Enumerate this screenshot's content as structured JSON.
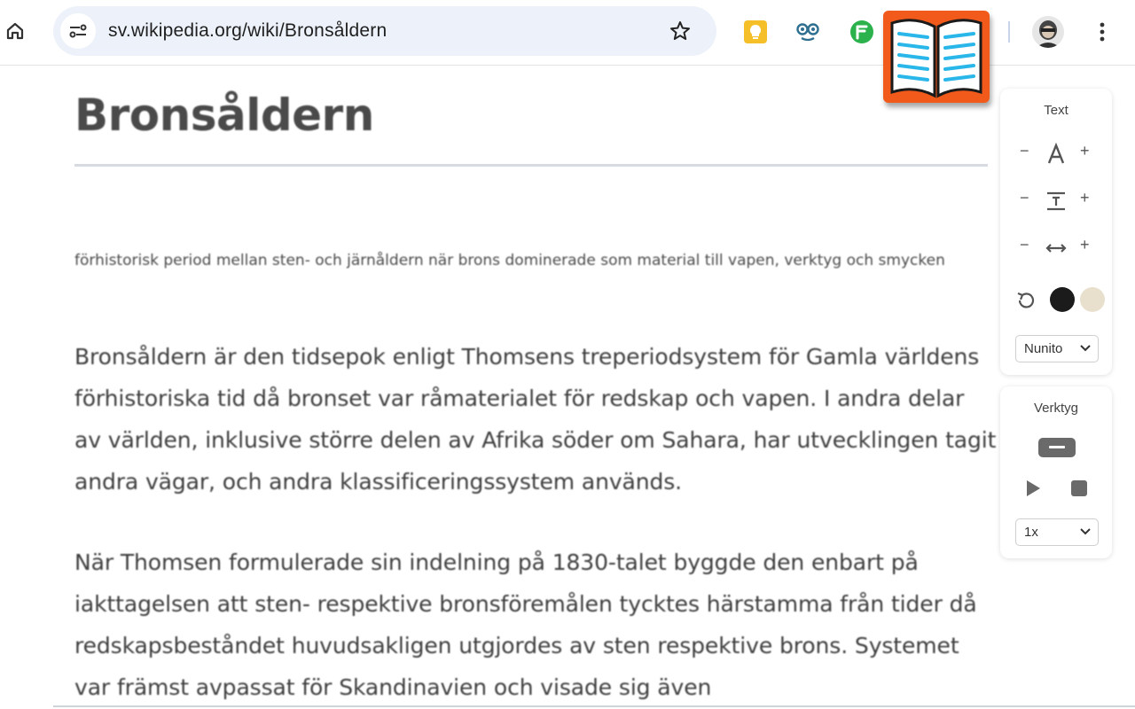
{
  "browser": {
    "url": "sv.wikipedia.org/wiki/Bronsåldern"
  },
  "article": {
    "title": "Bronsåldern",
    "short_description": "förhistorisk period mellan sten- och järnåldern när brons dominerade som material till vapen, verktyg och smycken",
    "paragraphs": [
      "Bronsåldern är den tidsepok enligt Thomsens treperiodsystem för Gamla världens förhistoriska tid då bronset var råmaterialet för redskap och vapen. I andra delar av världen, inklusive större delen av Afrika söder om Sahara, har utvecklingen tagit andra vägar, och andra klassificeringssystem används.",
      "När Thomsen formulerade sin indelning på 1830-talet byggde den enbart på iakttagelsen att sten- respektive bronsföremålen tycktes härstamma från tider då redskapsbeståndet huvudsakligen utgjordes av sten respektive brons. Systemet var främst avpassat för Skandinavien och visade sig även"
    ]
  },
  "reader_panel": {
    "text_section": {
      "title": "Text",
      "minus": "−",
      "plus": "+",
      "font_select": "Nunito",
      "colors": {
        "dark": "#1b1b1b",
        "beige": "#e8e0cd"
      }
    },
    "tools_section": {
      "title": "Verktyg",
      "speed_select": "1x"
    }
  },
  "colors": {
    "omnibox_bg": "#edf2fa",
    "book_extension": "#f15a1a",
    "book_lines": "#29b6e8"
  }
}
